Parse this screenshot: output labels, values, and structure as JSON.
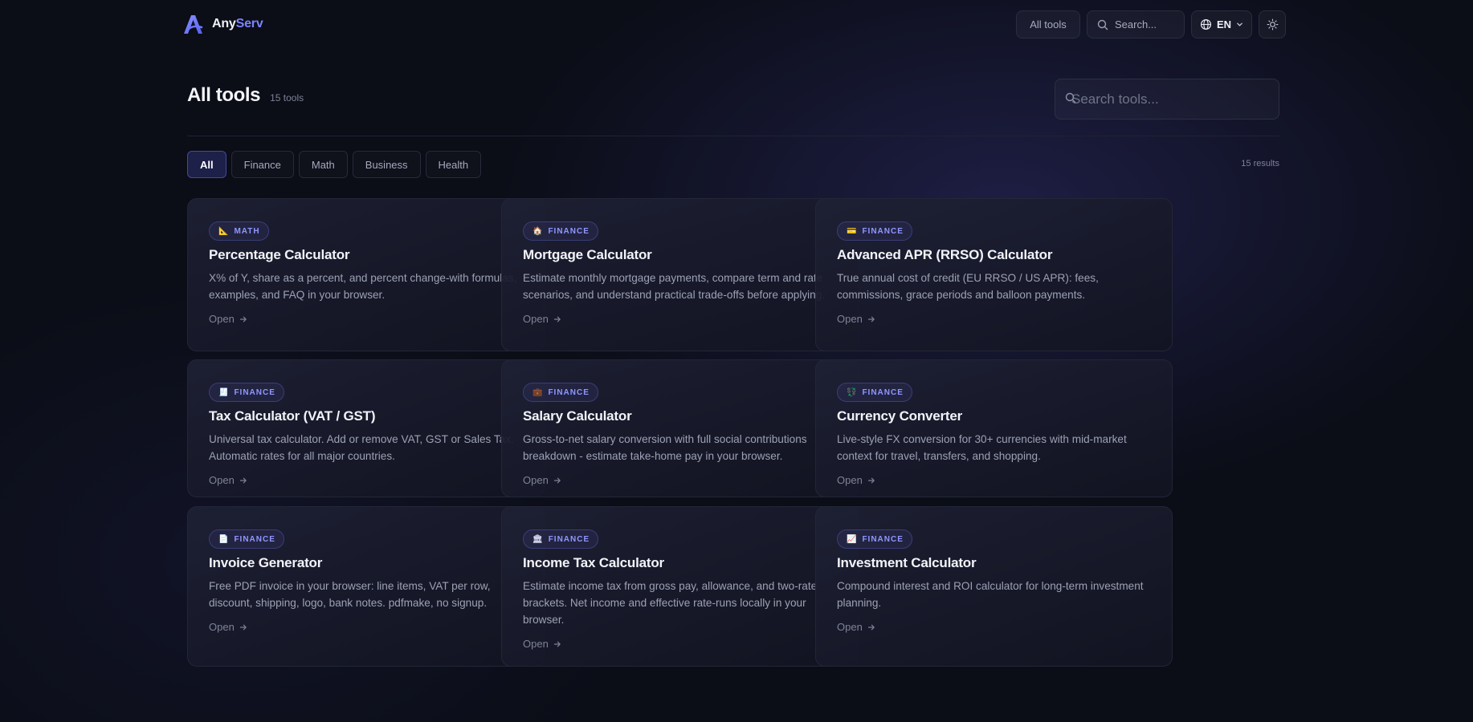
{
  "header": {
    "brand_first": "Any",
    "brand_second": "Serv",
    "all_tools_label": "All tools",
    "search_placeholder": "Search...",
    "language": "EN"
  },
  "main": {
    "title": "All tools",
    "count_label": "15 tools",
    "search_placeholder": "Search tools...",
    "results_label": "15 results",
    "filters": [
      "All",
      "Finance",
      "Math",
      "Business",
      "Health"
    ],
    "active_filter": "All"
  },
  "cards": [
    {
      "category": "MATH",
      "icon": "📐",
      "title": "Percentage Calculator",
      "description": "X% of Y, share as a percent, and percent change-with formulas, examples, and FAQ in your browser.",
      "cta": "Open"
    },
    {
      "category": "FINANCE",
      "icon": "🏠",
      "title": "Mortgage Calculator",
      "description": "Estimate monthly mortgage payments, compare term and rate scenarios, and understand practical trade-offs before applying.",
      "cta": "Open"
    },
    {
      "category": "FINANCE",
      "icon": "💳",
      "title": "Advanced APR (RRSO) Calculator",
      "description": "True annual cost of credit (EU RRSO / US APR): fees, commissions, grace periods and balloon payments.",
      "cta": "Open"
    },
    {
      "category": "FINANCE",
      "icon": "🧾",
      "title": "Tax Calculator (VAT / GST)",
      "description": "Universal tax calculator. Add or remove VAT, GST or Sales Tax. Automatic rates for all major countries.",
      "cta": "Open"
    },
    {
      "category": "FINANCE",
      "icon": "💼",
      "title": "Salary Calculator",
      "description": "Gross-to-net salary conversion with full social contributions breakdown - estimate take-home pay in your browser.",
      "cta": "Open"
    },
    {
      "category": "FINANCE",
      "icon": "💱",
      "title": "Currency Converter",
      "description": "Live-style FX conversion for 30+ currencies with mid-market context for travel, transfers, and shopping.",
      "cta": "Open"
    },
    {
      "category": "FINANCE",
      "icon": "📄",
      "title": "Invoice Generator",
      "description": "Free PDF invoice in your browser: line items, VAT per row, discount, shipping, logo, bank notes. pdfmake, no signup.",
      "cta": "Open"
    },
    {
      "category": "FINANCE",
      "icon": "🏛",
      "title": "Income Tax Calculator",
      "description": "Estimate income tax from gross pay, allowance, and two-rate brackets. Net income and effective rate-runs locally in your browser.",
      "cta": "Open"
    },
    {
      "category": "FINANCE",
      "icon": "📈",
      "title": "Investment Calculator",
      "description": "Compound interest and ROI calculator for long-term investment planning.",
      "cta": "Open"
    }
  ]
}
